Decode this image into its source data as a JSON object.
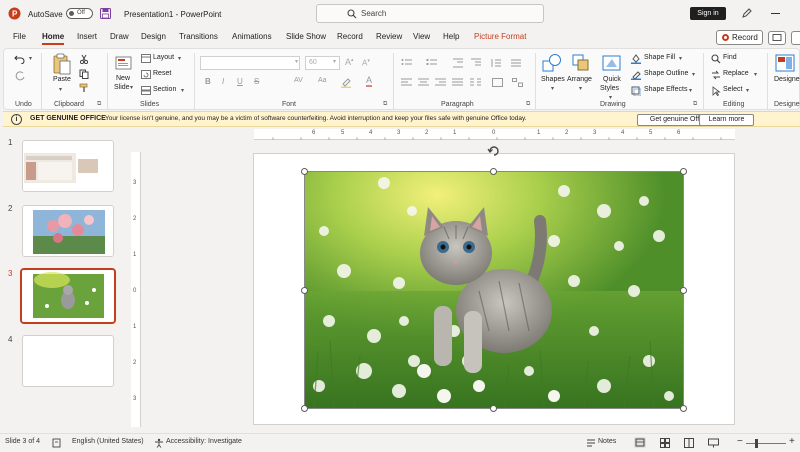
{
  "titlebar": {
    "autosave_label": "AutoSave",
    "autosave_state": "Off",
    "doc_title": "Presentation1  -  PowerPoint",
    "search_placeholder": "Search",
    "signin_label": "Sign in"
  },
  "tabs": [
    {
      "label": "File"
    },
    {
      "label": "Home"
    },
    {
      "label": "Insert"
    },
    {
      "label": "Draw"
    },
    {
      "label": "Design"
    },
    {
      "label": "Transitions"
    },
    {
      "label": "Animations"
    },
    {
      "label": "Slide Show"
    },
    {
      "label": "Record"
    },
    {
      "label": "Review"
    },
    {
      "label": "View"
    },
    {
      "label": "Help"
    },
    {
      "label": "Picture Format"
    }
  ],
  "record_button": "Record",
  "ribbon": {
    "undo_group": "Undo",
    "clipboard": {
      "group": "Clipboard",
      "paste": "Paste"
    },
    "slides": {
      "group": "Slides",
      "new_slide_1": "New",
      "new_slide_2": "Slide",
      "layout": "Layout",
      "reset": "Reset",
      "section": "Section"
    },
    "font": {
      "group": "Font",
      "size_value": "60"
    },
    "paragraph": {
      "group": "Paragraph"
    },
    "drawing": {
      "group": "Drawing",
      "shapes": "Shapes",
      "arrange": "Arrange",
      "quick_styles_1": "Quick",
      "quick_styles_2": "Styles",
      "shape_fill": "Shape Fill",
      "shape_outline": "Shape Outline",
      "shape_effects": "Shape Effects"
    },
    "editing": {
      "group": "Editing",
      "find": "Find",
      "replace": "Replace",
      "select": "Select"
    },
    "designer": {
      "label": "Designe",
      "group": "Designe"
    }
  },
  "banner": {
    "title": "GET GENUINE OFFICE",
    "message": "Your license isn't genuine, and you may be a victim of software counterfeiting. Avoid interruption and keep your files safe with genuine Office today.",
    "primary_button": "Get genuine Office",
    "secondary_button": "Learn more"
  },
  "thumbnails": [
    {
      "number": "1"
    },
    {
      "number": "2"
    },
    {
      "number": "3"
    },
    {
      "number": "4"
    }
  ],
  "ruler": {
    "h_labels": [
      "6",
      "5",
      "4",
      "3",
      "2",
      "1",
      "0",
      "1",
      "2",
      "3",
      "4",
      "5",
      "6"
    ],
    "v_labels": [
      "3",
      "2",
      "1",
      "0",
      "1",
      "2",
      "3"
    ]
  },
  "statusbar": {
    "slide_info": "Slide 3 of 4",
    "language": "English (United States)",
    "accessibility": "Accessibility: Investigate",
    "notes": "Notes"
  },
  "colors": {
    "accent": "#c43e1c",
    "banner_bg": "#fff4ce",
    "selected_thumb": "#c43e1c"
  }
}
